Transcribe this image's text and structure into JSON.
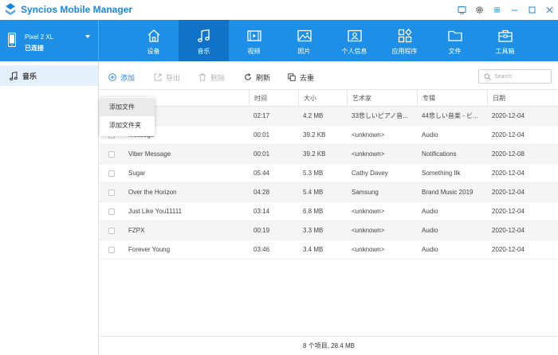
{
  "app": {
    "title": "Syncios Mobile Manager",
    "brand_color": "#1E8FE6"
  },
  "window_controls": [
    {
      "name": "feedback-icon"
    },
    {
      "name": "settings-icon"
    },
    {
      "name": "menu-icon"
    },
    {
      "name": "minimize-icon"
    },
    {
      "name": "maximize-icon"
    },
    {
      "name": "close-icon"
    }
  ],
  "device": {
    "name": "Pixel 2 XL",
    "status": "已连接"
  },
  "nav": {
    "tabs": [
      {
        "label": "设备",
        "icon": "home-icon"
      },
      {
        "label": "音乐",
        "icon": "music-icon",
        "active": true
      },
      {
        "label": "视频",
        "icon": "video-icon"
      },
      {
        "label": "照片",
        "icon": "photo-icon"
      },
      {
        "label": "个人信息",
        "icon": "contacts-icon"
      },
      {
        "label": "应用程序",
        "icon": "apps-icon"
      },
      {
        "label": "文件",
        "icon": "folder-icon"
      },
      {
        "label": "工具箱",
        "icon": "toolbox-icon"
      }
    ]
  },
  "sidebar": {
    "items": [
      {
        "label": "音乐",
        "icon": "music-note-icon",
        "selected": true
      }
    ]
  },
  "toolbar": {
    "add_label": "添加",
    "export_label": "导出",
    "delete_label": "删除",
    "refresh_label": "刷新",
    "dedup_label": "去重",
    "search_placeholder": "Search"
  },
  "add_menu": {
    "items": [
      "添加文件",
      "添加文件夹"
    ]
  },
  "table": {
    "columns": [
      "时间",
      "大小",
      "艺术家",
      "专辑",
      "日期"
    ],
    "rows": [
      {
        "title": "",
        "time": "02:17",
        "size": "4.2 MB",
        "artist": "33悲しいピアノ音...",
        "album": "44悲しい音楽 - ビ...",
        "date": "2020-12-04"
      },
      {
        "title": "Message",
        "time": "00:01",
        "size": "39.2 KB",
        "artist": "<unknown>",
        "album": "Audio",
        "date": "2020-12-04"
      },
      {
        "title": "Viber Message",
        "time": "00:01",
        "size": "39.2 KB",
        "artist": "<unknown>",
        "album": "Notifications",
        "date": "2020-12-08"
      },
      {
        "title": "Sugar",
        "time": "05:44",
        "size": "5.3 MB",
        "artist": "Cathy Davey",
        "album": "Something Ilk",
        "date": "2020-12-04"
      },
      {
        "title": "Over the Horizon",
        "time": "04:28",
        "size": "5.4 MB",
        "artist": "Samsung",
        "album": "Brand Music 2019",
        "date": "2020-12-04"
      },
      {
        "title": "Just Like You11111",
        "time": "03:14",
        "size": "6.8 MB",
        "artist": "<unknown>",
        "album": "Audio",
        "date": "2020-12-04"
      },
      {
        "title": "FZPX",
        "time": "00:19",
        "size": "3.3 MB",
        "artist": "<unknown>",
        "album": "Audio",
        "date": "2020-12-04"
      },
      {
        "title": "Forever Young",
        "time": "03:46",
        "size": "3.4 MB",
        "artist": "<unknown>",
        "album": "Audio",
        "date": "2020-12-04"
      }
    ]
  },
  "footer": {
    "summary": "8 个项目, 28.4 MB"
  }
}
